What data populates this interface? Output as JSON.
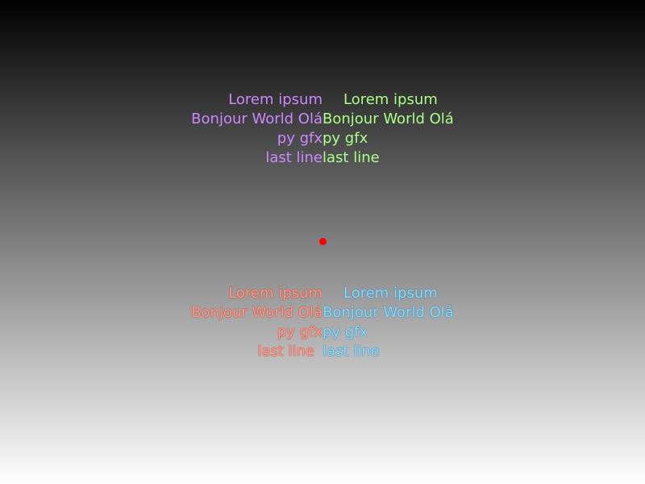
{
  "blocks": {
    "top_left": {
      "lines": [
        "Lorem ipsum",
        "Bonjour World Olá",
        "py gfx",
        "last line"
      ],
      "color": "#cc88ff"
    },
    "top_right": {
      "lines": [
        "Lorem ipsum",
        "Bonjour World Olá",
        "py gfx",
        "last line"
      ],
      "color": "#aaff88"
    },
    "bottom_left": {
      "lines": [
        "Lorem ipsum",
        "Bonjour World Olá",
        "py gfx",
        "last line"
      ],
      "color": "#ff9988"
    },
    "bottom_right": {
      "lines": [
        "Lorem ipsum",
        "Bonjour World Olá",
        "py gfx",
        "last line"
      ],
      "color": "#88ddff"
    }
  },
  "marker": {
    "color": "#ff0000"
  },
  "background": {
    "gradient_top": "#000000",
    "gradient_bottom": "#ffffff"
  }
}
